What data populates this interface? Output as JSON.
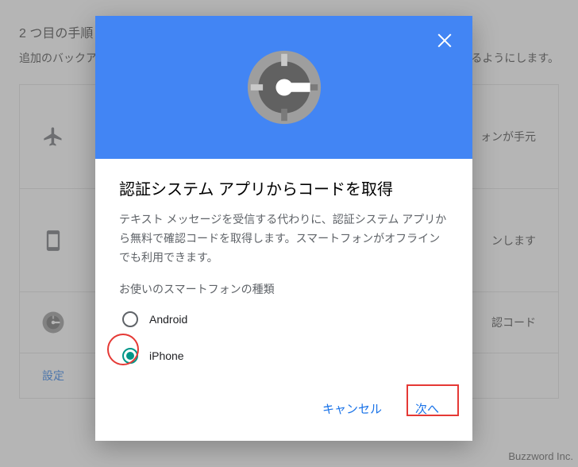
{
  "background": {
    "title": "2 つ目の手順",
    "subtitle_line": "追加のバックア",
    "subtitle_tail": "きるようにします。",
    "card1_tail": "ォンが手元",
    "card2_tail": "ンします",
    "card3_tail": "認コード",
    "settings_label": "設定"
  },
  "modal": {
    "title": "認証システム アプリからコードを取得",
    "description": "テキスト メッセージを受信する代わりに、認証システム アプリから無料で確認コードを取得します。スマートフォンがオフラインでも利用できます。",
    "question": "お使いのスマートフォンの種類",
    "options": [
      {
        "label": "Android",
        "selected": false
      },
      {
        "label": "iPhone",
        "selected": true
      }
    ],
    "cancel_label": "キャンセル",
    "next_label": "次へ"
  },
  "watermark": "Buzzword Inc."
}
